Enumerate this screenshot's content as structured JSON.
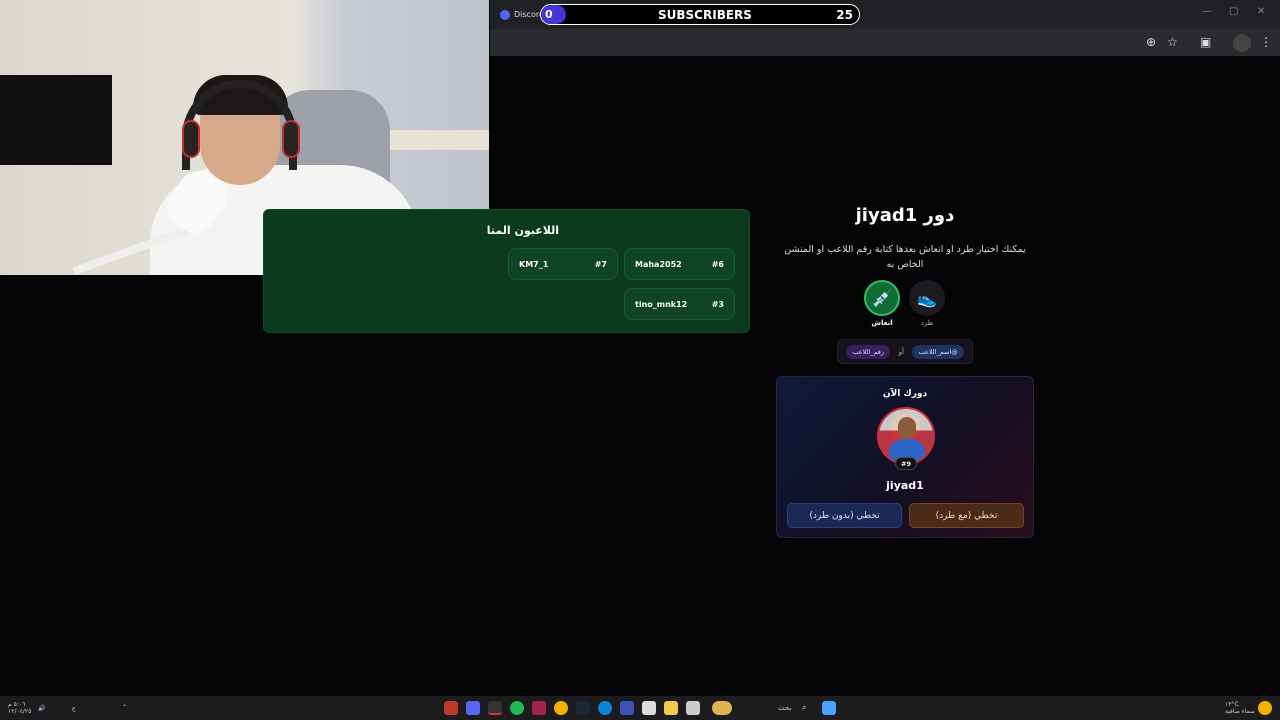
{
  "browser": {
    "tab_title": "Discord",
    "tab_close": "×",
    "min_icon": "—",
    "max_icon": "▢",
    "close_icon": "✕"
  },
  "overlay": {
    "current": "0",
    "label": "SUBSCRIBERS",
    "goal": "25",
    "progress": 0.0
  },
  "players_panel": {
    "title": "اللاعبون المتا",
    "players": [
      {
        "name": "Maha2052",
        "num": "#6"
      },
      {
        "name": "KM7_1",
        "num": "#7"
      },
      {
        "name": "tino_mnk12",
        "num": "#3"
      }
    ]
  },
  "turn_panel": {
    "title": "دور jiyad1",
    "description": "يمكنك اختيار طرد او انعاش بعدها كتابة رقم اللاعب او المنشن الخاص به",
    "actions": [
      {
        "label": "طرد",
        "icon": "sneaker-icon"
      },
      {
        "label": "انعاش",
        "icon": "syringe-icon"
      }
    ],
    "chip_mention": "@اسم_اللاعب",
    "chip_or": "أو",
    "chip_number": "رقم_اللاعب",
    "now_label": "دورك الآن",
    "player_number": "#9",
    "player_name": "jiyad1",
    "skip_kick": "تخطي (مع طرد)",
    "skip_no_kick": "تخطي (بدون طرد)"
  },
  "taskbar": {
    "search": "بحث",
    "weather": "١٣°C",
    "weather_desc": "سماء صافية",
    "time": "٥:٠٦ م",
    "date": "١٢/٠٤/٢٥",
    "lang": "ع"
  }
}
